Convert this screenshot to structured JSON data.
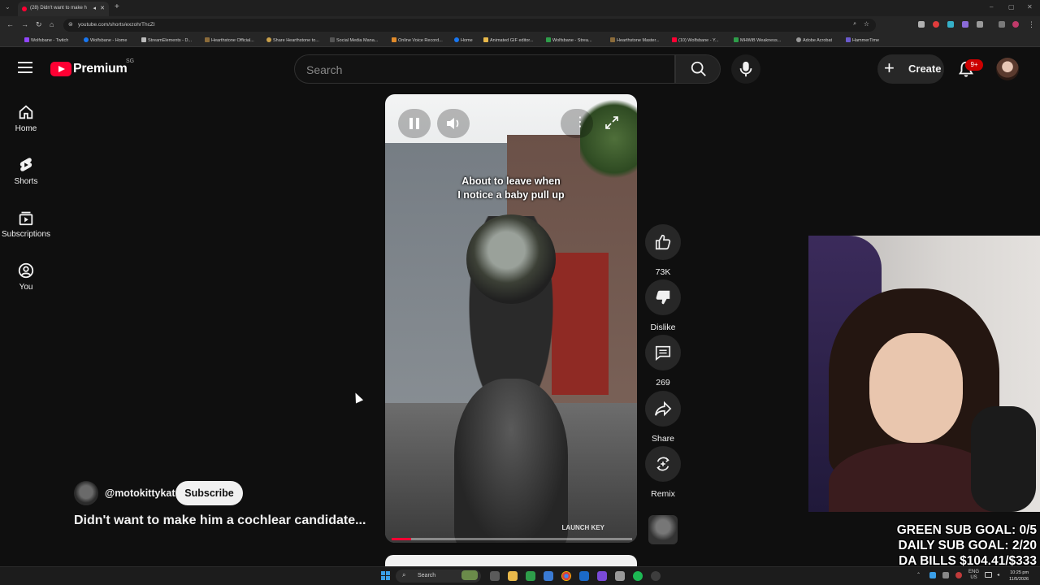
{
  "browser": {
    "tab_title": "(28) Didn't want to make h",
    "url": "youtube.com/shorts/exzohrThcZI",
    "bookmarks": [
      "Wolfsbane - Twitch",
      "Wolfsbane - Home",
      "StreamElements - D...",
      "Hearthstone Official...",
      "Share Hearthstone to...",
      "Social Media Mana...",
      "Online Voice Record...",
      "Home",
      "Animated GIF editor...",
      "Wolfsbane - Strea...",
      "Hearthstone Master...",
      "(10) Wolfsbane - Y...",
      "MHWiB Weakness...",
      "Adobe Acrobat",
      "HammerTime"
    ]
  },
  "header": {
    "logo_text": "Premium",
    "country_code": "SG",
    "search_placeholder": "Search",
    "create_label": "Create",
    "notification_count": "9+"
  },
  "sidebar": {
    "items": [
      {
        "label": "Home",
        "icon": "home-icon"
      },
      {
        "label": "Shorts",
        "icon": "shorts-icon"
      },
      {
        "label": "Subscriptions",
        "icon": "subscriptions-icon"
      },
      {
        "label": "You",
        "icon": "you-icon"
      }
    ]
  },
  "short": {
    "caption_line1": "About to leave when",
    "caption_line2": "I notice a baby pull up",
    "overlay_tag": "LAUNCH KEY",
    "progress": 0.08,
    "channel": "@motokittykat",
    "subscribe_label": "Subscribe",
    "title": "Didn't want to make him a cochlear candidate..."
  },
  "actions": {
    "like_count": "73K",
    "dislike_label": "Dislike",
    "comment_count": "269",
    "share_label": "Share",
    "remix_label": "Remix"
  },
  "stream_overlay": {
    "goal1": "GREEN SUB GOAL: 0/5",
    "goal2": "DAILY SUB GOAL: 2/20",
    "goal3": "DA BILLS $104.41/$333"
  },
  "taskbar": {
    "search_label": "Search",
    "lang_line1": "ENG",
    "lang_line2": "US",
    "time": "10:25 pm",
    "date": "11/5/2026"
  },
  "colors": {
    "accent": "#ff0033",
    "background": "#0f0f0f",
    "notification_badge": "#cc0000"
  }
}
